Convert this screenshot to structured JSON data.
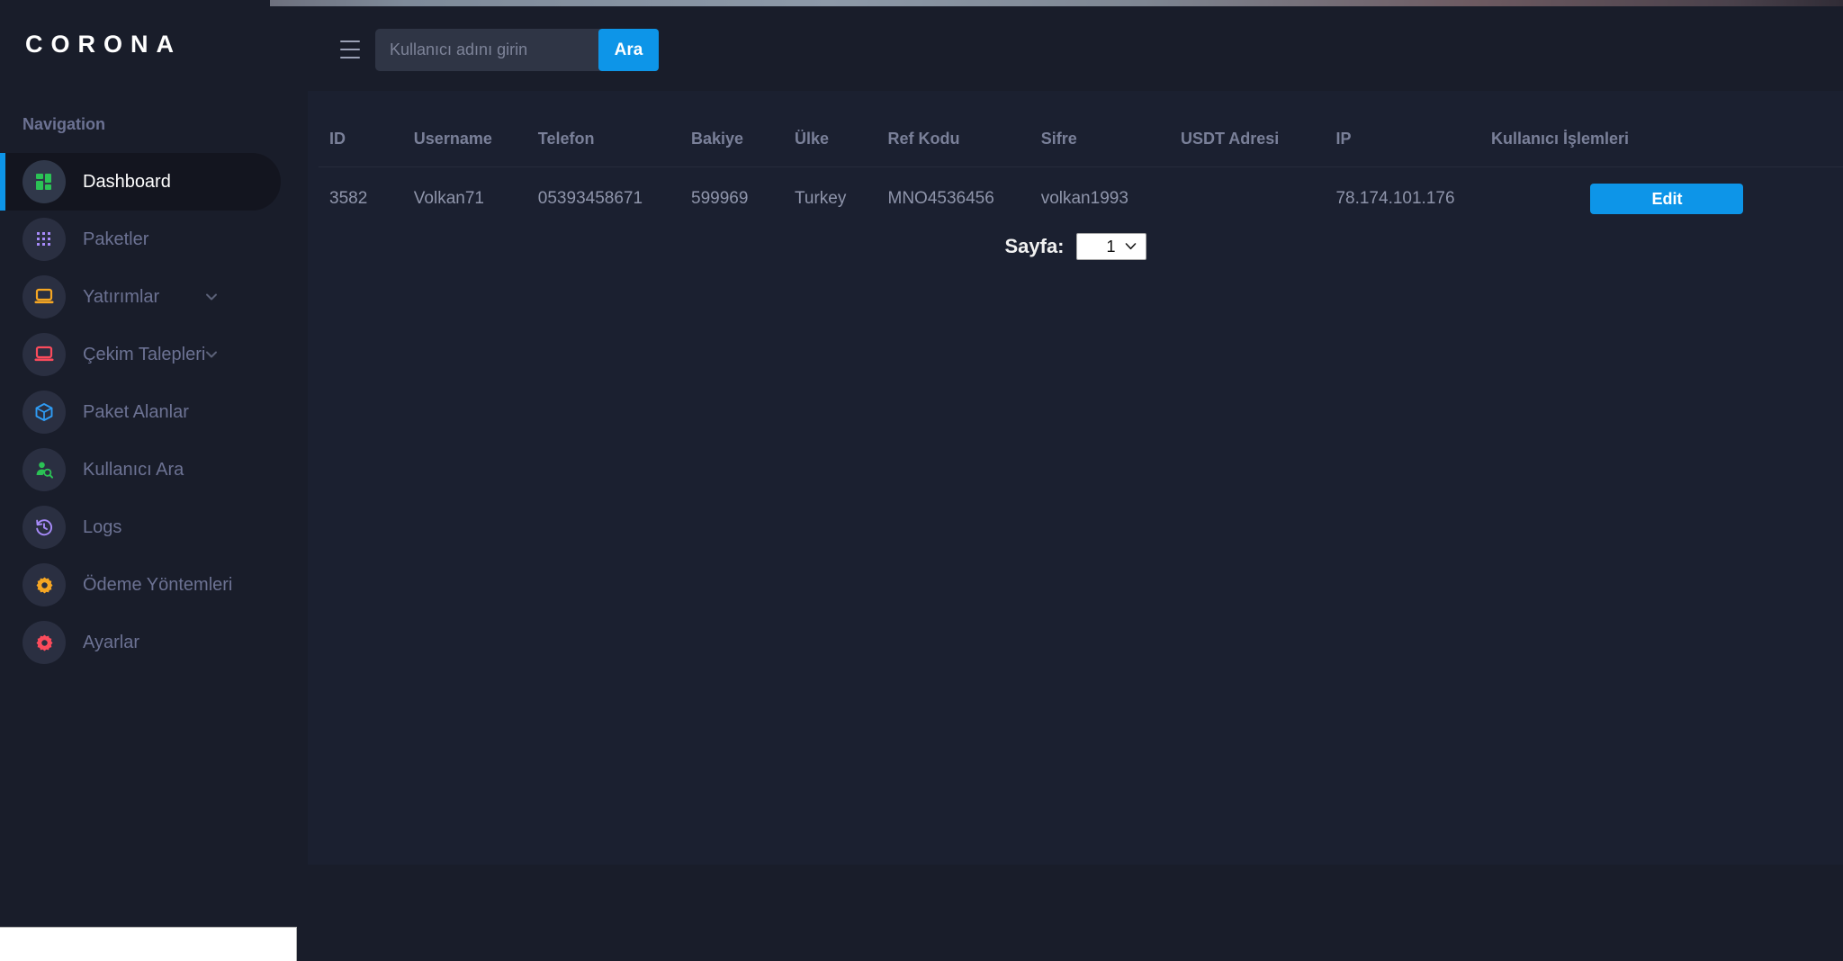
{
  "brand": {
    "name": "CORONA"
  },
  "sidebar": {
    "section_label": "Navigation",
    "items": [
      {
        "label": "Dashboard",
        "icon": "grid-icon",
        "active": true,
        "chevron": false
      },
      {
        "label": "Paketler",
        "icon": "dots-grid-icon",
        "active": false,
        "chevron": false
      },
      {
        "label": "Yatırımlar",
        "icon": "laptop-icon",
        "active": false,
        "chevron": true
      },
      {
        "label": "Çekim Talepleri",
        "icon": "laptop-red-icon",
        "active": false,
        "chevron": true
      },
      {
        "label": "Paket Alanlar",
        "icon": "box-icon",
        "active": false,
        "chevron": false
      },
      {
        "label": "Kullanıcı Ara",
        "icon": "user-search-icon",
        "active": false,
        "chevron": false
      },
      {
        "label": "Logs",
        "icon": "history-clock-icon",
        "active": false,
        "chevron": false
      },
      {
        "label": "Ödeme Yöntemleri",
        "icon": "gear-yellow-icon",
        "active": false,
        "chevron": false
      },
      {
        "label": "Ayarlar",
        "icon": "gear-red-icon",
        "active": false,
        "chevron": false
      }
    ]
  },
  "header": {
    "menu_icon": "hamburger-icon",
    "search": {
      "placeholder": "Kullanıcı adını girin",
      "value": "",
      "button_label": "Ara"
    }
  },
  "table": {
    "columns": [
      "ID",
      "Username",
      "Telefon",
      "Bakiye",
      "Ülke",
      "Ref Kodu",
      "Sifre",
      "USDT Adresi",
      "IP",
      "Kullanıcı İşlemleri"
    ],
    "rows": [
      {
        "id": "3582",
        "username": "Volkan71",
        "telefon": "05393458671",
        "bakiye": "599969",
        "ulke": "Turkey",
        "ref_kodu": "MNO4536456",
        "sifre": "volkan1993",
        "usdt_adresi": "",
        "ip": "78.174.101.176",
        "action_label": "Edit"
      }
    ]
  },
  "pagination": {
    "label": "Sayfa:",
    "selected": "1",
    "options": [
      "1"
    ],
    "caret_icon": "chevron-down-icon"
  },
  "colors": {
    "accent": "#0d95e8",
    "sidebar_bg": "#191d2a",
    "content_bg": "#1b2030",
    "muted_text": "#6c7293",
    "icon_green": "#2bc255",
    "icon_purple": "#a78bfa",
    "icon_yellow": "#f5a623",
    "icon_red": "#fb4b5c",
    "icon_blue": "#2f9cf5"
  }
}
